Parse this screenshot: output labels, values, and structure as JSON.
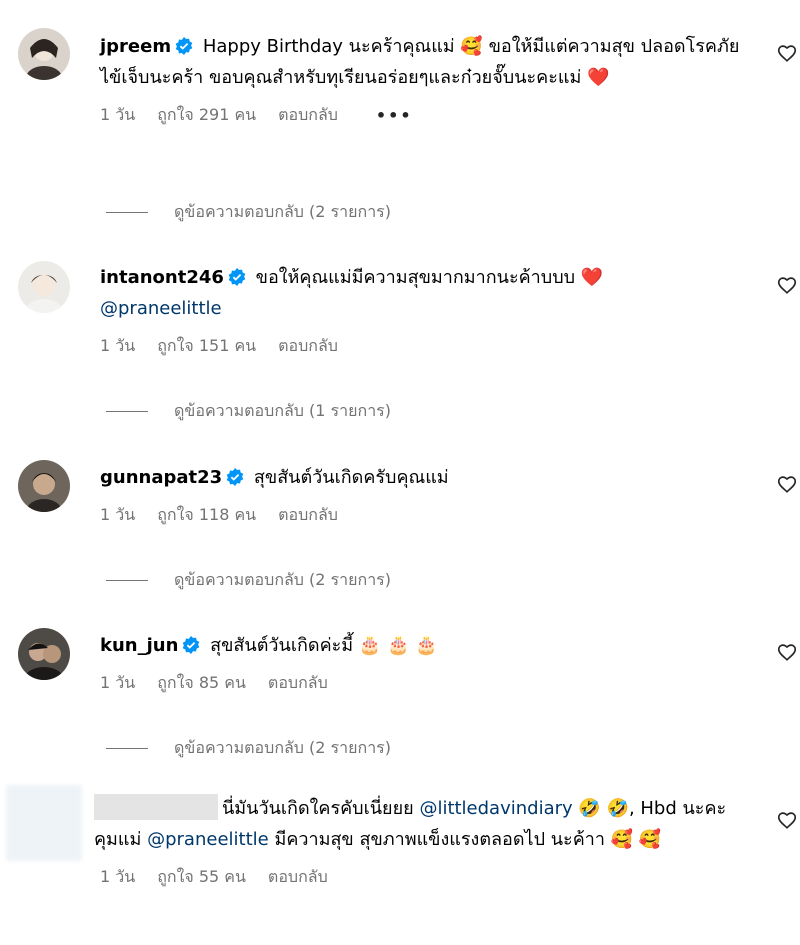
{
  "comments": [
    {
      "username": "jpreem",
      "text_a": "Happy Birthday นะคร้าคุณแม่",
      "emoji_a": "🥰",
      "text_b": "ขอให้มีแต่ความสุข ปลอดโรคภัยไข้เจ็บนะคร้า ขอบคุณสำหรับทุเรียนอร่อยๆและก๋วยจั๊บนะคะแม่",
      "emoji_b": "❤️",
      "time": "1 วัน",
      "likes": "ถูกใจ 291 คน",
      "reply": "ตอบกลับ",
      "more": "•••",
      "view_replies": "ดูข้อความตอบกลับ (2 รายการ)"
    },
    {
      "username": "intanont246",
      "text_a": "ขอให้คุณแม่มีความสุขมากมากนะค้าบบบ",
      "emoji_a": "❤️",
      "mention": "@praneelittle",
      "time": "1 วัน",
      "likes": "ถูกใจ 151 คน",
      "reply": "ตอบกลับ",
      "view_replies": "ดูข้อความตอบกลับ (1 รายการ)"
    },
    {
      "username": "gunnapat23",
      "text_a": "สุขสันต์วันเกิดครับคุณแม่",
      "time": "1 วัน",
      "likes": "ถูกใจ 118 คน",
      "reply": "ตอบกลับ",
      "view_replies": "ดูข้อความตอบกลับ (2 รายการ)"
    },
    {
      "username": "kun_jun",
      "text_a": "สุขสันต์วันเกิดค่ะมี้",
      "emoji_a": "🎂 🎂 🎂",
      "time": "1 วัน",
      "likes": "ถูกใจ 85 คน",
      "reply": "ตอบกลับ",
      "view_replies": "ดูข้อความตอบกลับ (2 รายการ)"
    },
    {
      "text_a": "นี่มันวันเกิดใครคับเนี่ยยย",
      "mention_a": "@littledavindiary",
      "emoji_a": "🤣 🤣",
      "text_b": ", Hbd นะคะคุมแม่",
      "mention_b": "@praneelittle",
      "text_c": "มีความสุข สุขภาพแข็งแรงตลอดไป นะค้าา",
      "emoji_b": "🥰 🥰",
      "time": "1 วัน",
      "likes": "ถูกใจ 55 คน",
      "reply": "ตอบกลับ"
    }
  ],
  "colors": {
    "secondary_text": "#737373",
    "mention": "#00376b",
    "verified_badge": "#0095f6",
    "like_heart_outline": "#262626"
  },
  "icons": {
    "verified": "verified-badge-icon",
    "like": "heart-outline-icon"
  }
}
